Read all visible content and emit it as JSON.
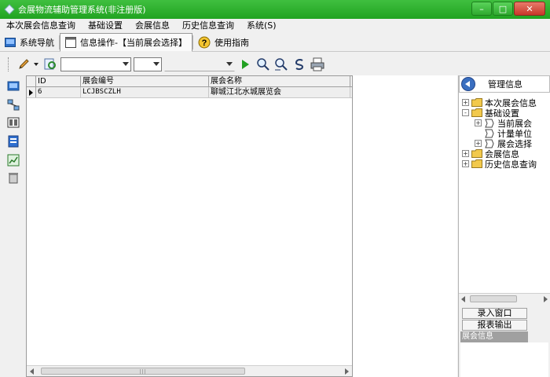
{
  "window": {
    "title": "会展物流辅助管理系统(非注册版)",
    "controls": [
      "–",
      "□",
      "✕"
    ]
  },
  "menubar": {
    "items": [
      "本次展会信息查询",
      "基础设置",
      "会展信息",
      "历史信息查询",
      "系统(S)"
    ]
  },
  "tabs": [
    {
      "label": "系统导航",
      "icon": "system-nav-icon"
    },
    {
      "label": "信息操作-【当前展会选择】",
      "icon": "info-op-icon",
      "active": true
    },
    {
      "label": "使用指南",
      "icon": "help-icon"
    }
  ],
  "toolbar": {
    "combo1_value": "",
    "combo2_value": "",
    "combo3_value": ""
  },
  "grid": {
    "columns": [
      "ID",
      "展会编号",
      "展会名称"
    ],
    "rows": [
      {
        "id": "6",
        "code": "LCJBSCZLH",
        "name": "聊城江北水城展览会"
      }
    ]
  },
  "right_panel": {
    "title": "管理信息",
    "tree": [
      {
        "label": "本次展会信息",
        "level": 0,
        "expander": "+"
      },
      {
        "label": "基础设置",
        "level": 0,
        "expander": "-"
      },
      {
        "label": "当前展会",
        "level": 1,
        "expander": "+"
      },
      {
        "label": "计量单位",
        "level": 1,
        "expander": ""
      },
      {
        "label": "展会选择",
        "level": 1,
        "expander": "+"
      },
      {
        "label": "会展信息",
        "level": 0,
        "expander": "+"
      },
      {
        "label": "历史信息查询",
        "level": 0,
        "expander": "+"
      }
    ],
    "buttons": [
      "录入窗口",
      "报表输出"
    ],
    "selected_item": "展会信息"
  },
  "colors": {
    "titlebar": "#2fb02f",
    "folder": "#f2c94c",
    "run": "#22a022"
  }
}
